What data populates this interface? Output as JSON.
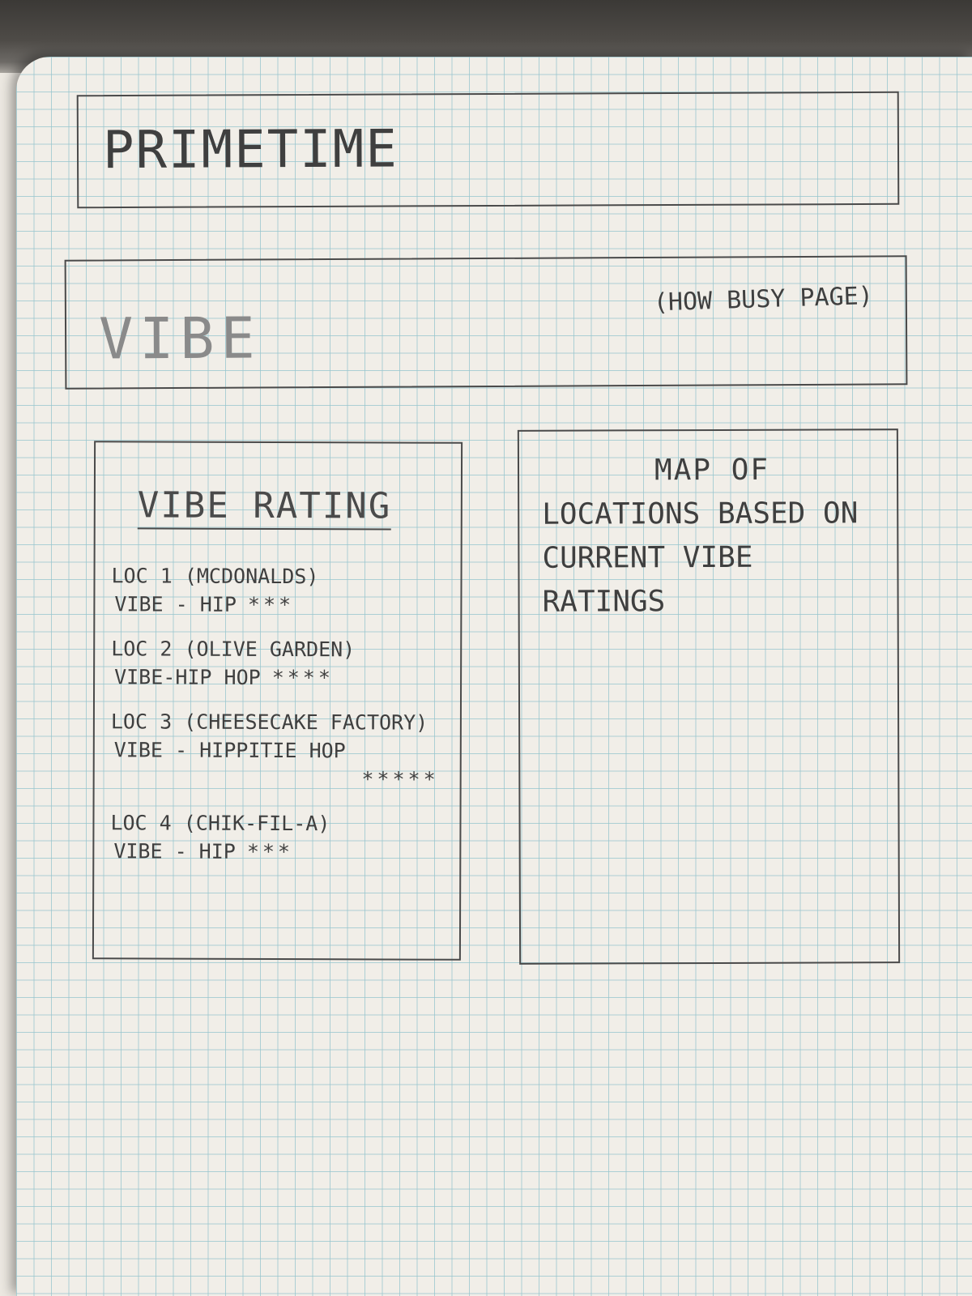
{
  "header": {
    "title": "PRIMETIME"
  },
  "vibe_section": {
    "label": "VIBE",
    "note": "(HOW BUSY PAGE)"
  },
  "rating_panel": {
    "heading": "VIBE RATING",
    "locations": [
      {
        "name": "LOC 1 (MCDONALDS)",
        "vibe": "VIBE - HIP",
        "stars": "***"
      },
      {
        "name": "LOC 2 (OLIVE GARDEN)",
        "vibe": "VIBE-HIP HOP",
        "stars": "****"
      },
      {
        "name": "LOC 3 (CHEESECAKE FACTORY)",
        "vibe": "VIBE - HIPPITIE HOP",
        "stars": "*****"
      },
      {
        "name": "LOC 4 (CHIK-FIL-A)",
        "vibe": "VIBE - HIP",
        "stars": "***"
      }
    ]
  },
  "map_panel": {
    "line1": "MAP OF",
    "line2": "LOCATIONS BASED ON CURRENT VIBE RATINGS"
  }
}
